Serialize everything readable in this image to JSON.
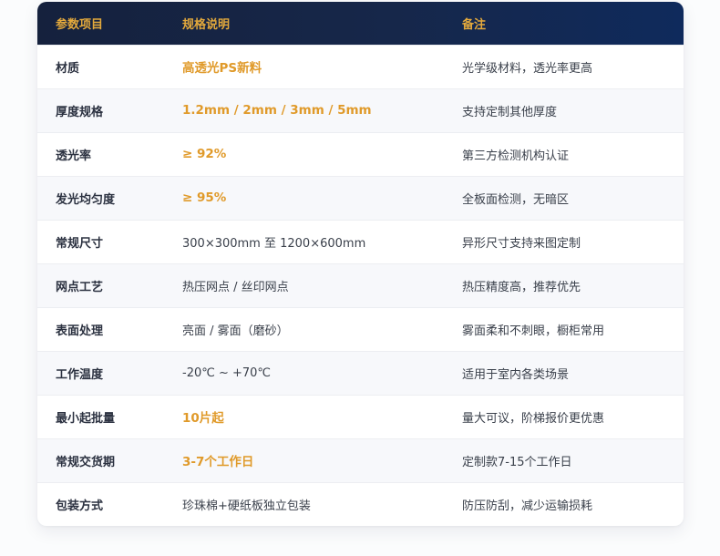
{
  "table": {
    "headers": [
      "参数项目",
      "规格说明",
      "备注"
    ],
    "rows": [
      {
        "param": "材质",
        "spec": "高透光PS新料",
        "note": "光学级材料，透光率更高",
        "highlight": true
      },
      {
        "param": "厚度规格",
        "spec": "1.2mm / 2mm / 3mm / 5mm",
        "note": "支持定制其他厚度",
        "highlight": true
      },
      {
        "param": "透光率",
        "spec": "≥ 92%",
        "note": "第三方检测机构认证",
        "highlight": true
      },
      {
        "param": "发光均匀度",
        "spec": "≥ 95%",
        "note": "全板面检测，无暗区",
        "highlight": true
      },
      {
        "param": "常规尺寸",
        "spec": "300×300mm 至 1200×600mm",
        "note": "异形尺寸支持来图定制",
        "highlight": false
      },
      {
        "param": "网点工艺",
        "spec": "热压网点 / 丝印网点",
        "note": "热压精度高，推荐优先",
        "highlight": false
      },
      {
        "param": "表面处理",
        "spec": "亮面 / 雾面（磨砂）",
        "note": "雾面柔和不刺眼，橱柜常用",
        "highlight": false
      },
      {
        "param": "工作温度",
        "spec": "-20℃ ~ +70℃",
        "note": "适用于室内各类场景",
        "highlight": false
      },
      {
        "param": "最小起批量",
        "spec": "10片起",
        "note": "量大可议，阶梯报价更优惠",
        "highlight": true
      },
      {
        "param": "常规交货期",
        "spec": "3-7个工作日",
        "note": "定制款7-15个工作日",
        "highlight": true
      },
      {
        "param": "包装方式",
        "spec": "珍珠棉+硬纸板独立包装",
        "note": "防压防刮，减少运输损耗",
        "highlight": false
      }
    ]
  },
  "colors": {
    "header_bg": "#16274a",
    "header_text": "#e3a93c",
    "highlight_text": "#e09a2a"
  }
}
